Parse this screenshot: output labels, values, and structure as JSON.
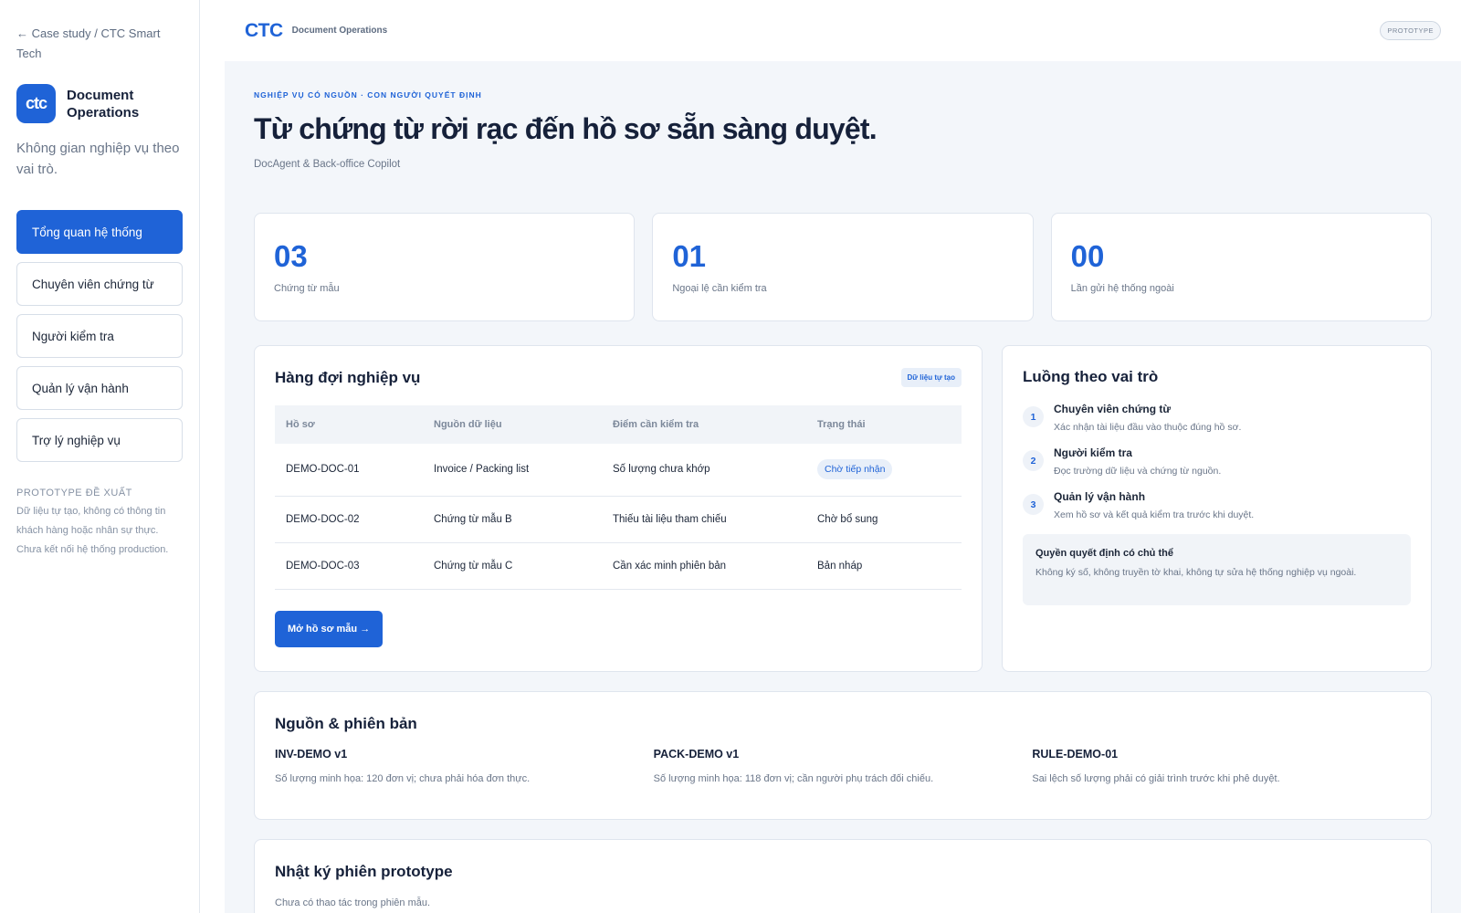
{
  "sidebar": {
    "back_link": "← Case study / CTC Smart Tech",
    "brand_logo": "ctc",
    "brand_name": "Document Operations",
    "description": "Không gian nghiệp vụ theo vai trò.",
    "nav": [
      {
        "label": "Tổng quan hệ thống",
        "active": true
      },
      {
        "label": "Chuyên viên chứng từ",
        "active": false
      },
      {
        "label": "Người kiểm tra",
        "active": false
      },
      {
        "label": "Quản lý vận hành",
        "active": false
      },
      {
        "label": "Trợ lý nghiệp vụ",
        "active": false
      }
    ],
    "note_title": "PROTOTYPE ĐỀ XUẤT",
    "note_text": "Dữ liệu tự tạo, không có thông tin khách hàng hoặc nhân sự thực. Chưa kết nối hệ thống production."
  },
  "topbar": {
    "logo": "CTC",
    "title": "Document Operations",
    "badge": "PROTOTYPE"
  },
  "hero": {
    "kicker": "NGHIỆP VỤ CÓ NGUỒN · CON NGƯỜI QUYẾT ĐỊNH",
    "title": "Từ chứng từ rời rạc đến hồ sơ sẵn sàng duyệt.",
    "subtitle": "DocAgent & Back-office Copilot"
  },
  "stats": [
    {
      "value": "03",
      "label": "Chứng từ mẫu"
    },
    {
      "value": "01",
      "label": "Ngoại lệ cần kiểm tra"
    },
    {
      "value": "00",
      "label": "Lần gửi hệ thống ngoài"
    }
  ],
  "queue": {
    "title": "Hàng đợi nghiệp vụ",
    "tag": "Dữ liệu tự tạo",
    "columns": [
      "Hồ sơ",
      "Nguồn dữ liệu",
      "Điểm cần kiểm tra",
      "Trạng thái"
    ],
    "rows": [
      [
        "DEMO-DOC-01",
        "Invoice / Packing list",
        "Số lượng chưa khớp",
        "Chờ tiếp nhận"
      ],
      [
        "DEMO-DOC-02",
        "Chứng từ mẫu B",
        "Thiếu tài liệu tham chiếu",
        "Chờ bổ sung"
      ],
      [
        "DEMO-DOC-03",
        "Chứng từ mẫu C",
        "Cần xác minh phiên bản",
        "Bản nháp"
      ]
    ],
    "button": "Mở hồ sơ mẫu →"
  },
  "flow": {
    "title": "Luồng theo vai trò",
    "steps": [
      {
        "num": "1",
        "title": "Chuyên viên chứng từ",
        "desc": "Xác nhận tài liệu đầu vào thuộc đúng hồ sơ."
      },
      {
        "num": "2",
        "title": "Người kiểm tra",
        "desc": "Đọc trường dữ liệu và chứng từ nguồn."
      },
      {
        "num": "3",
        "title": "Quản lý vận hành",
        "desc": "Xem hồ sơ và kết quả kiểm tra trước khi duyệt."
      }
    ],
    "note_title": "Quyền quyết định có chủ thể",
    "note_text": "Không ký số, không truyền tờ khai, không tự sửa hệ thống nghiệp vụ ngoài."
  },
  "sources": {
    "title": "Nguồn & phiên bản",
    "items": [
      {
        "title": "INV-DEMO v1",
        "desc": "Số lượng minh họa: 120 đơn vị; chưa phải hóa đơn thực."
      },
      {
        "title": "PACK-DEMO v1",
        "desc": "Số lượng minh họa: 118 đơn vị; cần người phụ trách đối chiếu."
      },
      {
        "title": "RULE-DEMO-01",
        "desc": "Sai lệch số lượng phải có giải trình trước khi phê duyệt."
      }
    ]
  },
  "log": {
    "title": "Nhật ký phiên prototype",
    "empty": "Chưa có thao tác trong phiên mẫu."
  },
  "colors": {
    "accent": "#1f63d7",
    "background": "#f3f6fa",
    "text": "#16213a"
  }
}
